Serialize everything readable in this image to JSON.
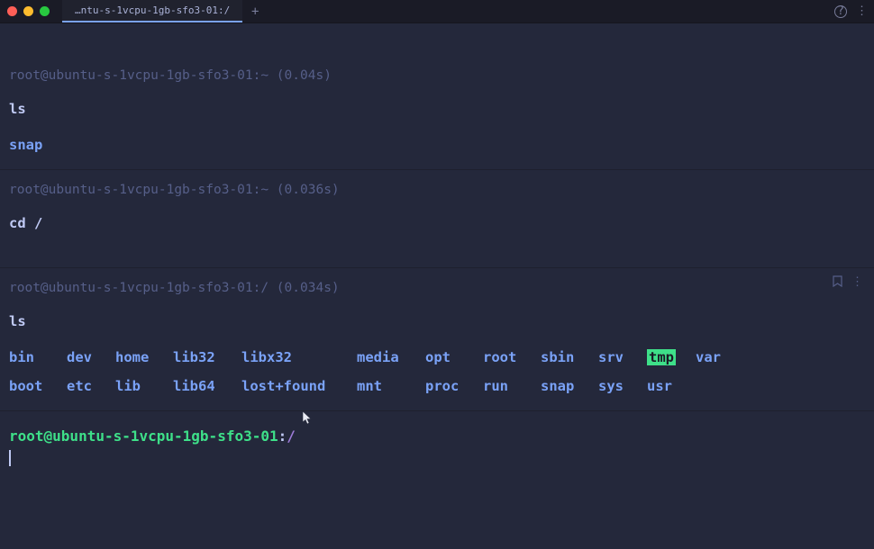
{
  "window": {
    "tab_title": "…ntu-s-1vcpu-1gb-sfo3-01:/",
    "new_tab": "+"
  },
  "blocks": [
    {
      "prompt": "root@ubuntu-s-1vcpu-1gb-sfo3-01:~ (0.04s)",
      "command": "ls",
      "output_simple": "snap"
    },
    {
      "prompt": "root@ubuntu-s-1vcpu-1gb-sfo3-01:~ (0.036s)",
      "command": "cd /"
    },
    {
      "prompt": "root@ubuntu-s-1vcpu-1gb-sfo3-01:/ (0.034s)",
      "command": "ls",
      "ls_root": {
        "row1": [
          "bin",
          "dev",
          "home",
          "lib32",
          "libx32",
          "media",
          "opt",
          "root",
          "sbin",
          "srv",
          "tmp",
          "var"
        ],
        "row2": [
          "boot",
          "etc",
          "lib",
          "lib64",
          "lost+found",
          "mnt",
          "proc",
          "run",
          "snap",
          "sys",
          "usr",
          ""
        ],
        "selected": "tmp"
      }
    }
  ],
  "current": {
    "user_host": "root@ubuntu-s-1vcpu-1gb-sfo3-01",
    "colon": ":",
    "cwd": "/"
  }
}
